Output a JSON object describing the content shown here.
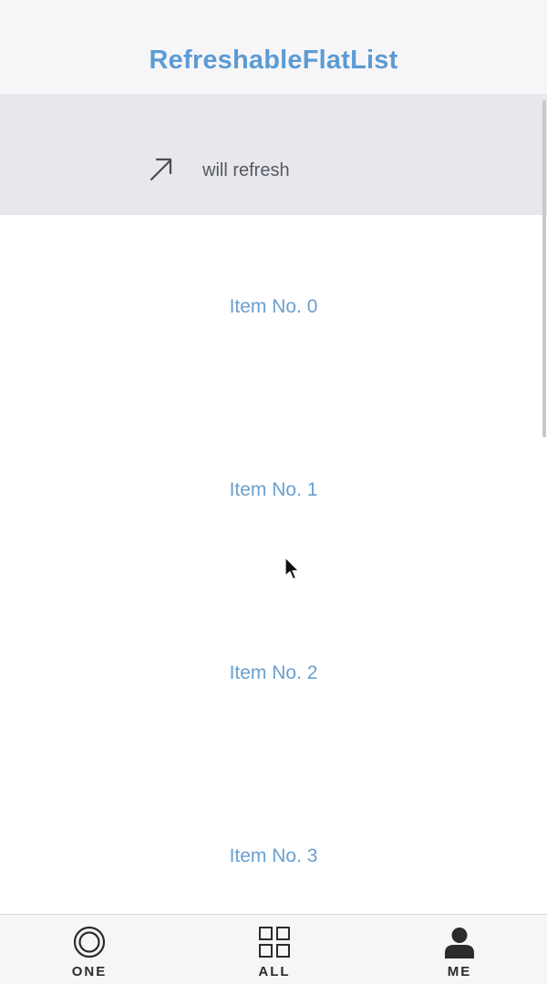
{
  "header": {
    "title": "RefreshableFlatList"
  },
  "refresh_header": {
    "status_text": "will refresh",
    "icon": "arrow-up-right-icon"
  },
  "list": {
    "items": [
      {
        "label": "Item No. 0"
      },
      {
        "label": "Item No. 1"
      },
      {
        "label": "Item No. 2"
      },
      {
        "label": "Item No. 3"
      }
    ]
  },
  "tab_bar": {
    "tabs": [
      {
        "label": "ONE",
        "icon": "circle-target-icon"
      },
      {
        "label": "ALL",
        "icon": "grid-icon"
      },
      {
        "label": "ME",
        "icon": "person-icon",
        "selected": true
      }
    ]
  },
  "colors": {
    "title": "#5d9bd3",
    "item_text": "#6aa0cf",
    "refresh_bg": "#e7e7ed",
    "header_bg": "#f6f6f8"
  }
}
